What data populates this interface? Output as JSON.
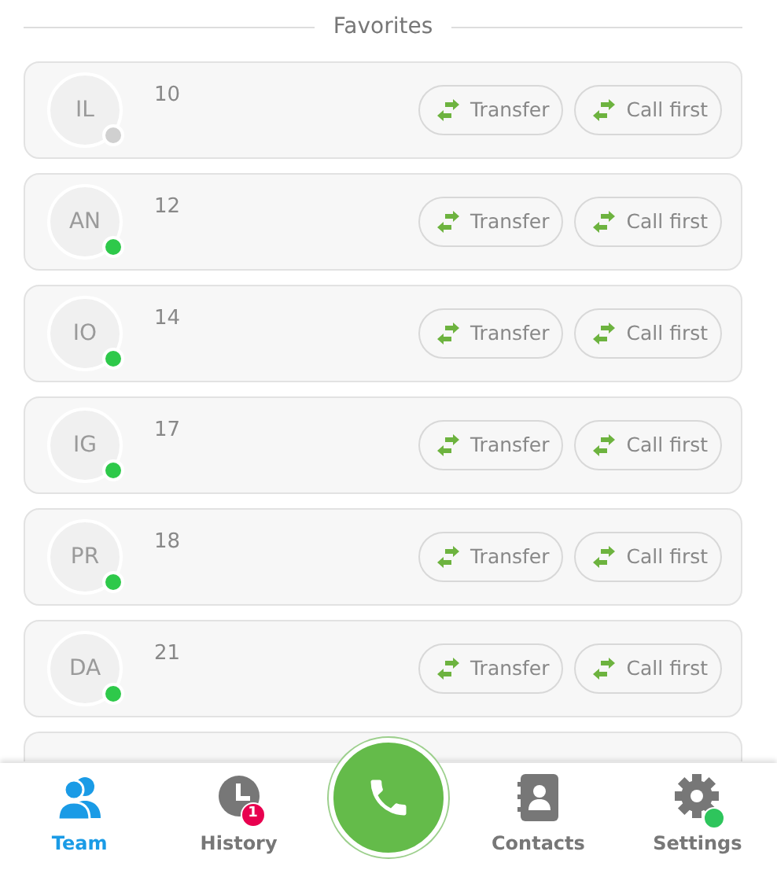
{
  "section_title": "Favorites",
  "favorites": [
    {
      "initials": "IL",
      "number": "10",
      "online": false,
      "actions": [
        "Transfer",
        "Call first"
      ]
    },
    {
      "initials": "AN",
      "number": "12",
      "online": true,
      "actions": [
        "Transfer",
        "Call first"
      ]
    },
    {
      "initials": "IO",
      "number": "14",
      "online": true,
      "actions": [
        "Transfer",
        "Call first"
      ]
    },
    {
      "initials": "IG",
      "number": "17",
      "online": true,
      "actions": [
        "Transfer",
        "Call first"
      ]
    },
    {
      "initials": "PR",
      "number": "18",
      "online": true,
      "actions": [
        "Transfer",
        "Call first"
      ]
    },
    {
      "initials": "DA",
      "number": "21",
      "online": true,
      "actions": [
        "Transfer",
        "Call first"
      ]
    },
    {
      "partial": true
    }
  ],
  "tab_bar": [
    {
      "kind": "team",
      "label": "Team",
      "selected": true
    },
    {
      "kind": "history",
      "label": "History",
      "selected": false,
      "badge": "1"
    },
    {
      "kind": "call"
    },
    {
      "kind": "contacts",
      "label": "Contacts",
      "selected": false
    },
    {
      "kind": "settings",
      "label": "Settings",
      "selected": false,
      "online": true
    }
  ]
}
